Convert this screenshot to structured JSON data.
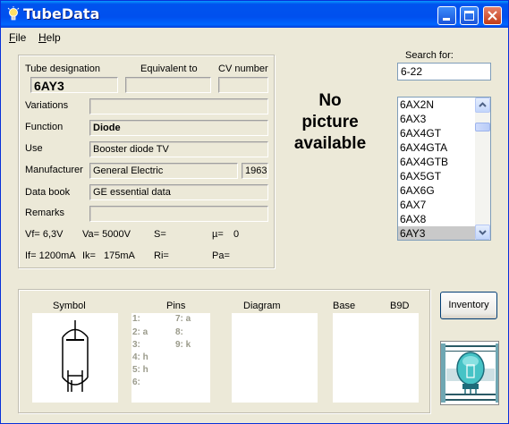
{
  "window": {
    "title": "TubeData"
  },
  "menu": {
    "file": "File",
    "help": "Help"
  },
  "fields": {
    "tube_designation_label": "Tube designation",
    "tube_designation": "6AY3",
    "equivalent_label": "Equivalent to",
    "equivalent": "",
    "cv_label": "CV number",
    "cv": "",
    "variations_label": "Variations",
    "variations": "",
    "function_label": "Function",
    "function": "Diode",
    "use_label": "Use",
    "use": "Booster diode TV",
    "manufacturer_label": "Manufacturer",
    "manufacturer": "General Electric",
    "year": "1963",
    "databook_label": "Data book",
    "databook": "GE essential data",
    "remarks_label": "Remarks",
    "remarks": ""
  },
  "params": {
    "vf": "Vf= 6,3V",
    "va": "Va= 5000V",
    "s": "S=",
    "mu": "µ=",
    "mu_value": "0",
    "if": "If= 1200mA",
    "ik": "Ik=",
    "ik_value": "175mA",
    "ri": "Ri=",
    "pa": "Pa="
  },
  "picture": {
    "notice_line1": "No",
    "notice_line2": "picture",
    "notice_line3": "available"
  },
  "search": {
    "label": "Search for:",
    "value": "6-22"
  },
  "tube_list": [
    "6AX2N",
    "6AX3",
    "6AX4GT",
    "6AX4GTA",
    "6AX4GTB",
    "6AX5GT",
    "6AX6G",
    "6AX7",
    "6AX8",
    "6AY3"
  ],
  "selected_tube": "6AY3",
  "lower": {
    "symbol_label": "Symbol",
    "pins_label": "Pins",
    "diagram_label": "Diagram",
    "base_label": "Base",
    "base_value": "B9D",
    "pins_left": [
      "1:",
      "2: a",
      "3:",
      "4: h",
      "5: h",
      "6:"
    ],
    "pins_right": [
      "7: a",
      "8:",
      "9: k"
    ]
  },
  "buttons": {
    "inventory": "Inventory"
  },
  "colors": {
    "title_bar": "#0053ee",
    "selection": "#c9c9c9",
    "pin_text": "#9a9a8a"
  }
}
